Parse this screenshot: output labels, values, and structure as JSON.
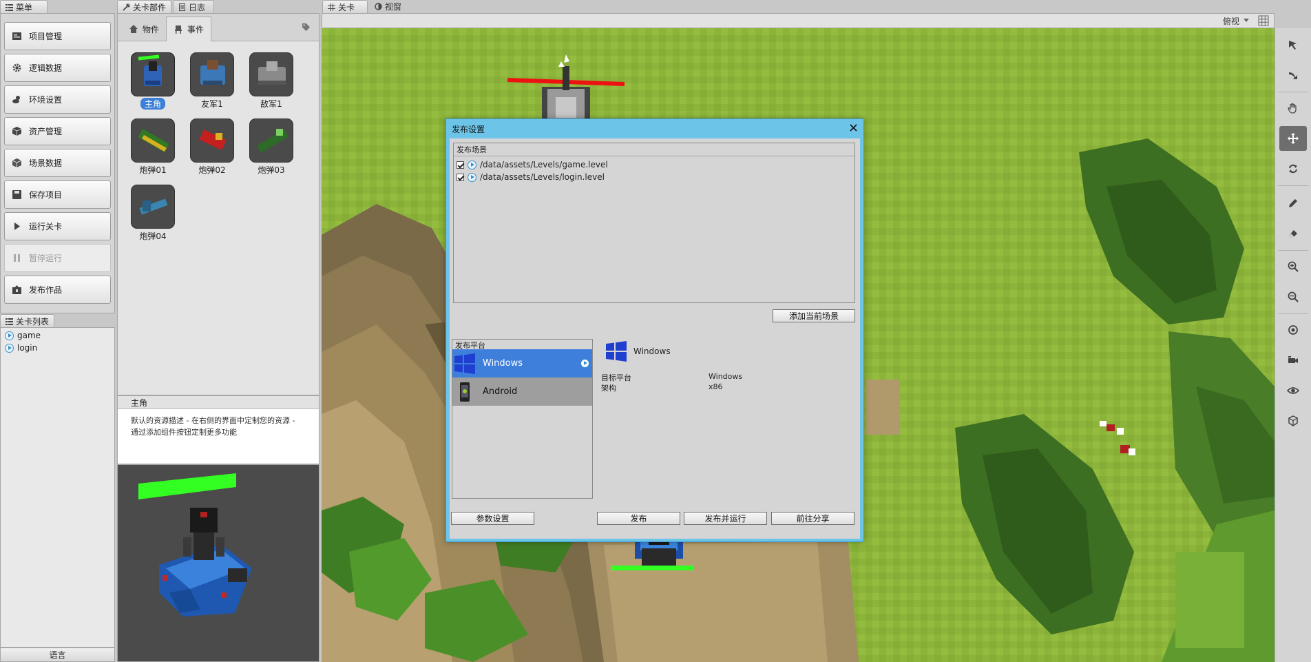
{
  "tabs": {
    "menu": "菜单",
    "parts": "关卡部件",
    "log": "日志",
    "level": "关卡",
    "view": "视窗",
    "level_list": "关卡列表"
  },
  "menu": {
    "items": [
      {
        "label": "项目管理",
        "icon": "folder-icon",
        "enabled": true
      },
      {
        "label": "逻辑数据",
        "icon": "gear-icon",
        "enabled": true
      },
      {
        "label": "环境设置",
        "icon": "weather-icon",
        "enabled": true
      },
      {
        "label": "资产管理",
        "icon": "box-icon",
        "enabled": true
      },
      {
        "label": "场景数据",
        "icon": "cube-icon",
        "enabled": true
      },
      {
        "label": "保存项目",
        "icon": "save-icon",
        "enabled": true
      },
      {
        "label": "运行关卡",
        "icon": "play-icon",
        "enabled": true
      },
      {
        "label": "暂停运行",
        "icon": "pause-icon",
        "enabled": false
      },
      {
        "label": "发布作品",
        "icon": "publish-icon",
        "enabled": true
      }
    ]
  },
  "levels": [
    "game",
    "login"
  ],
  "language": "语言",
  "parts": {
    "subtabs": [
      "物件",
      "事件"
    ],
    "items": [
      {
        "label": "主角",
        "selected": true
      },
      {
        "label": "友军1",
        "selected": false
      },
      {
        "label": "敌军1",
        "selected": false
      },
      {
        "label": "炮弹01",
        "selected": false
      },
      {
        "label": "炮弹02",
        "selected": false
      },
      {
        "label": "炮弹03",
        "selected": false
      },
      {
        "label": "炮弹04",
        "selected": false
      }
    ]
  },
  "description": {
    "title": "主角",
    "text_line1": "默认的资源描述 - 在右侧的界面中定制您的资源 -",
    "text_line2": "通过添加组件按钮定制更多功能"
  },
  "scene": {
    "view_mode": "俯视"
  },
  "dialog": {
    "title": "发布设置",
    "scenes_group": "发布场景",
    "scenes": [
      {
        "path": "/data/assets/Levels/game.level",
        "checked": true
      },
      {
        "path": "/data/assets/Levels/login.level",
        "checked": true
      }
    ],
    "add_scene_button": "添加当前场景",
    "platform_group": "发布平台",
    "platforms": [
      {
        "name": "Windows",
        "selected": true
      },
      {
        "name": "Android",
        "selected": false
      }
    ],
    "selected_platform": "Windows",
    "info": [
      {
        "key": "目标平台",
        "value": "Windows"
      },
      {
        "key": "架构",
        "value": "x86"
      }
    ],
    "buttons": {
      "params": "参数设置",
      "publish": "发布",
      "publish_run": "发布并运行",
      "share": "前往分享"
    }
  },
  "colors": {
    "accent_blue": "#3f7fdc",
    "dialog_border": "#6cc4e8",
    "grass": "#8cb43a",
    "health_green": "#33ff22",
    "health_red": "#ee1111"
  }
}
